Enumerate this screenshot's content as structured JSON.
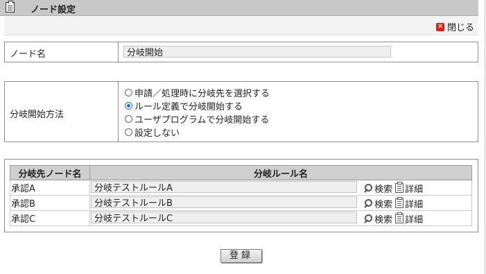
{
  "header": {
    "title": "ノード設定"
  },
  "close_label": "閉じる",
  "node_name": {
    "label": "ノード名",
    "value": "分岐開始"
  },
  "method": {
    "label": "分岐開始方法",
    "options": [
      {
        "label": "申請／処理時に分岐先を選択する",
        "selected": false
      },
      {
        "label": "ルール定義で分岐開始する",
        "selected": true
      },
      {
        "label": "ユーザプログラムで分岐開始する",
        "selected": false
      },
      {
        "label": "設定しない",
        "selected": false
      }
    ]
  },
  "rules_table": {
    "columns": [
      "分岐先ノード名",
      "分岐ルール名"
    ],
    "search_label": "検索",
    "detail_label": "詳細",
    "rows": [
      {
        "node": "承認A",
        "rule": "分岐テストルールA"
      },
      {
        "node": "承認B",
        "rule": "分岐テストルールB"
      },
      {
        "node": "承認C",
        "rule": "分岐テストルールC"
      }
    ]
  },
  "submit_label": "登録",
  "colors": {
    "close": "#d2241b",
    "header_bg": "#c8c8c8",
    "radio_selected": "#2a6bc4"
  }
}
